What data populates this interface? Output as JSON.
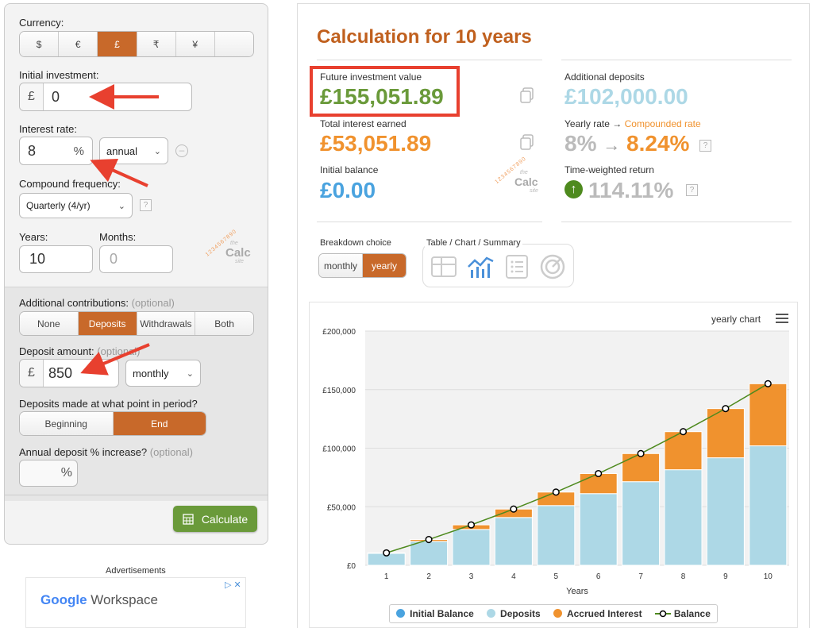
{
  "sidebar": {
    "currency_label": "Currency:",
    "currencies": [
      "$",
      "€",
      "£",
      "₹",
      "¥",
      ""
    ],
    "initial_label": "Initial investment:",
    "initial_prefix": "£",
    "initial_value": "0",
    "rate_label": "Interest rate:",
    "rate_value": "8",
    "rate_unit": "%",
    "rate_period": "annual",
    "compound_label": "Compound frequency:",
    "compound_value": "Quarterly (4/yr)",
    "help": "?",
    "years_label": "Years:",
    "years_value": "10",
    "months_label": "Months:",
    "months_value": "0",
    "logo_word": "Calc",
    "logo_the": "the",
    "logo_site": "site",
    "logo_digits": "1234567890",
    "contrib_label": "Additional contributions:",
    "contrib_optional": "(optional)",
    "contrib_options": [
      "None",
      "Deposits",
      "Withdrawals",
      "Both"
    ],
    "deposit_label": "Deposit amount:",
    "deposit_optional": "(optional)",
    "deposit_prefix": "£",
    "deposit_value": "850",
    "deposit_period": "monthly",
    "timing_label": "Deposits made at what point in period?",
    "timing_options": [
      "Beginning",
      "End"
    ],
    "increase_label": "Annual deposit % increase?",
    "increase_optional": "(optional)",
    "increase_unit": "%",
    "calculate_label": "Calculate"
  },
  "ads": {
    "label": "Advertisements",
    "brand": "Google",
    "product": "Workspace",
    "ad_close": "▷ ✕"
  },
  "results": {
    "title": "Calculation for 10 years",
    "fiv_label": "Future investment value",
    "fiv_value": "£155,051.89",
    "interest_label": "Total interest earned",
    "interest_value": "£53,051.89",
    "initial_label": "Initial balance",
    "initial_value": "£0.00",
    "deposits_label": "Additional deposits",
    "deposits_value": "£102,000.00",
    "yearly_label": "Yearly rate →",
    "compounded_label": "Compounded rate",
    "rate_from": "8%",
    "rate_arrow": "→",
    "rate_to": "8.24%",
    "twr_label": "Time-weighted return",
    "twr_value": "114.11%",
    "help": "?",
    "breakdown_label": "Breakdown choice",
    "breakdown_options": [
      "monthly",
      "yearly"
    ],
    "view_label": "Table / Chart / Summary",
    "chart_menu_label": "yearly chart"
  },
  "colors": {
    "accent": "#c8692a",
    "green": "#6a9a3a",
    "title": "#c0601e",
    "light_blue": "#add8e6",
    "blue": "#4aa3df",
    "orange": "#f0922e",
    "balance_line": "#4e8a1e"
  },
  "chart_data": {
    "type": "bar",
    "title": "",
    "xlabel": "Years",
    "ylabel": "",
    "categories": [
      "1",
      "2",
      "3",
      "4",
      "5",
      "6",
      "7",
      "8",
      "9",
      "10"
    ],
    "ylim": [
      0,
      200000
    ],
    "yticks": [
      "£0",
      "£50,000",
      "£100,000",
      "£150,000",
      "£200,000"
    ],
    "stacked": true,
    "grid": true,
    "series": [
      {
        "name": "Initial Balance",
        "values": [
          0,
          0,
          0,
          0,
          0,
          0,
          0,
          0,
          0,
          0
        ]
      },
      {
        "name": "Deposits",
        "values": [
          10200,
          20400,
          30600,
          40800,
          51000,
          61200,
          71400,
          81600,
          91800,
          102000
        ]
      },
      {
        "name": "Accrued Interest",
        "values": [
          400,
          1600,
          3900,
          7200,
          11500,
          17100,
          24000,
          32500,
          42000,
          53052
        ]
      },
      {
        "name": "Balance",
        "type": "line",
        "values": [
          10600,
          22000,
          34500,
          48000,
          62500,
          78300,
          95400,
          114100,
          133800,
          155052
        ]
      }
    ],
    "legend": "bottom"
  }
}
